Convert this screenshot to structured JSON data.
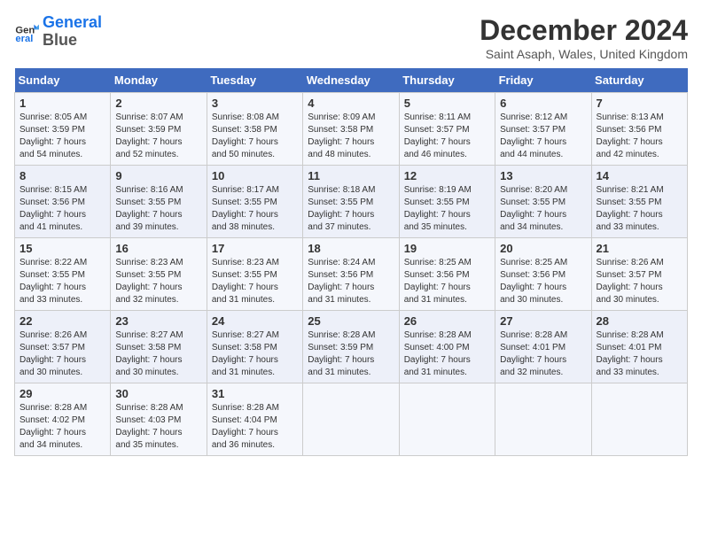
{
  "logo": {
    "line1": "General",
    "line2": "Blue"
  },
  "title": "December 2024",
  "subtitle": "Saint Asaph, Wales, United Kingdom",
  "days_of_week": [
    "Sunday",
    "Monday",
    "Tuesday",
    "Wednesday",
    "Thursday",
    "Friday",
    "Saturday"
  ],
  "weeks": [
    [
      {
        "day": "1",
        "rise": "8:05 AM",
        "set": "3:59 PM",
        "daylight": "7 hours and 54 minutes."
      },
      {
        "day": "2",
        "rise": "8:07 AM",
        "set": "3:59 PM",
        "daylight": "7 hours and 52 minutes."
      },
      {
        "day": "3",
        "rise": "8:08 AM",
        "set": "3:58 PM",
        "daylight": "7 hours and 50 minutes."
      },
      {
        "day": "4",
        "rise": "8:09 AM",
        "set": "3:58 PM",
        "daylight": "7 hours and 48 minutes."
      },
      {
        "day": "5",
        "rise": "8:11 AM",
        "set": "3:57 PM",
        "daylight": "7 hours and 46 minutes."
      },
      {
        "day": "6",
        "rise": "8:12 AM",
        "set": "3:57 PM",
        "daylight": "7 hours and 44 minutes."
      },
      {
        "day": "7",
        "rise": "8:13 AM",
        "set": "3:56 PM",
        "daylight": "7 hours and 42 minutes."
      }
    ],
    [
      {
        "day": "8",
        "rise": "8:15 AM",
        "set": "3:56 PM",
        "daylight": "7 hours and 41 minutes."
      },
      {
        "day": "9",
        "rise": "8:16 AM",
        "set": "3:55 PM",
        "daylight": "7 hours and 39 minutes."
      },
      {
        "day": "10",
        "rise": "8:17 AM",
        "set": "3:55 PM",
        "daylight": "7 hours and 38 minutes."
      },
      {
        "day": "11",
        "rise": "8:18 AM",
        "set": "3:55 PM",
        "daylight": "7 hours and 37 minutes."
      },
      {
        "day": "12",
        "rise": "8:19 AM",
        "set": "3:55 PM",
        "daylight": "7 hours and 35 minutes."
      },
      {
        "day": "13",
        "rise": "8:20 AM",
        "set": "3:55 PM",
        "daylight": "7 hours and 34 minutes."
      },
      {
        "day": "14",
        "rise": "8:21 AM",
        "set": "3:55 PM",
        "daylight": "7 hours and 33 minutes."
      }
    ],
    [
      {
        "day": "15",
        "rise": "8:22 AM",
        "set": "3:55 PM",
        "daylight": "7 hours and 33 minutes."
      },
      {
        "day": "16",
        "rise": "8:23 AM",
        "set": "3:55 PM",
        "daylight": "7 hours and 32 minutes."
      },
      {
        "day": "17",
        "rise": "8:23 AM",
        "set": "3:55 PM",
        "daylight": "7 hours and 31 minutes."
      },
      {
        "day": "18",
        "rise": "8:24 AM",
        "set": "3:56 PM",
        "daylight": "7 hours and 31 minutes."
      },
      {
        "day": "19",
        "rise": "8:25 AM",
        "set": "3:56 PM",
        "daylight": "7 hours and 31 minutes."
      },
      {
        "day": "20",
        "rise": "8:25 AM",
        "set": "3:56 PM",
        "daylight": "7 hours and 30 minutes."
      },
      {
        "day": "21",
        "rise": "8:26 AM",
        "set": "3:57 PM",
        "daylight": "7 hours and 30 minutes."
      }
    ],
    [
      {
        "day": "22",
        "rise": "8:26 AM",
        "set": "3:57 PM",
        "daylight": "7 hours and 30 minutes."
      },
      {
        "day": "23",
        "rise": "8:27 AM",
        "set": "3:58 PM",
        "daylight": "7 hours and 30 minutes."
      },
      {
        "day": "24",
        "rise": "8:27 AM",
        "set": "3:58 PM",
        "daylight": "7 hours and 31 minutes."
      },
      {
        "day": "25",
        "rise": "8:28 AM",
        "set": "3:59 PM",
        "daylight": "7 hours and 31 minutes."
      },
      {
        "day": "26",
        "rise": "8:28 AM",
        "set": "4:00 PM",
        "daylight": "7 hours and 31 minutes."
      },
      {
        "day": "27",
        "rise": "8:28 AM",
        "set": "4:01 PM",
        "daylight": "7 hours and 32 minutes."
      },
      {
        "day": "28",
        "rise": "8:28 AM",
        "set": "4:01 PM",
        "daylight": "7 hours and 33 minutes."
      }
    ],
    [
      {
        "day": "29",
        "rise": "8:28 AM",
        "set": "4:02 PM",
        "daylight": "7 hours and 34 minutes."
      },
      {
        "day": "30",
        "rise": "8:28 AM",
        "set": "4:03 PM",
        "daylight": "7 hours and 35 minutes."
      },
      {
        "day": "31",
        "rise": "8:28 AM",
        "set": "4:04 PM",
        "daylight": "7 hours and 36 minutes."
      },
      null,
      null,
      null,
      null
    ]
  ],
  "labels": {
    "sunrise": "Sunrise:",
    "sunset": "Sunset:",
    "daylight": "Daylight:"
  }
}
